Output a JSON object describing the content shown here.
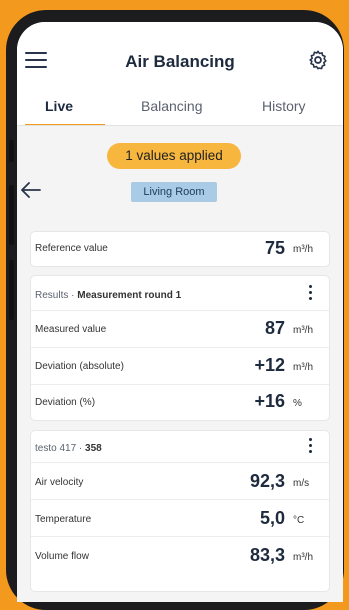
{
  "app": {
    "title": "Air Balancing"
  },
  "tabs": [
    {
      "label": "Live",
      "active": true
    },
    {
      "label": "Balancing",
      "active": false
    },
    {
      "label": "History",
      "active": false
    }
  ],
  "status": {
    "applied_badge": "1 values applied"
  },
  "room": {
    "name": "Living Room"
  },
  "reference": {
    "label": "Reference value",
    "value": "75",
    "unit": "m³/h"
  },
  "results": {
    "prefix": "Results · ",
    "title": "Measurement round 1",
    "rows": [
      {
        "label": "Measured value",
        "value": "87",
        "unit": "m³/h"
      },
      {
        "label": "Deviation (absolute)",
        "value": "+12",
        "unit": "m³/h"
      },
      {
        "label": "Deviation (%)",
        "value": "+16",
        "unit": "%"
      }
    ]
  },
  "device": {
    "name": "testo 417 · ",
    "serial": "358",
    "rows": [
      {
        "label": "Air velocity",
        "value": "92,3",
        "unit": "m/s"
      },
      {
        "label": "Temperature",
        "value": "5,0",
        "unit": "°C"
      },
      {
        "label": "Volume flow",
        "value": "83,3",
        "unit": "m³/h"
      }
    ]
  },
  "colors": {
    "accent": "#f39a1e",
    "badge": "#f7b63d",
    "room_tag": "#a9cbe6",
    "text": "#1e2a3e"
  },
  "icons": [
    "menu-icon",
    "gear-icon",
    "back-arrow-icon",
    "more-vertical-icon"
  ]
}
